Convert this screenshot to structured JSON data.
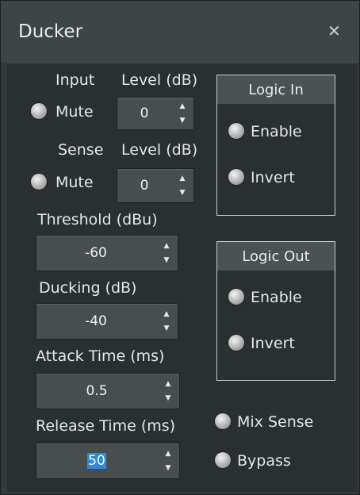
{
  "window": {
    "title": "Ducker",
    "close_icon": "close-icon"
  },
  "input": {
    "heading": "Input",
    "level_label": "Level (dB)",
    "mute_label": "Mute",
    "level_value": "0"
  },
  "sense": {
    "heading": "Sense",
    "level_label": "Level (dB)",
    "mute_label": "Mute",
    "level_value": "0"
  },
  "threshold": {
    "label": "Threshold (dBu)",
    "value": "-60"
  },
  "ducking": {
    "label": "Ducking (dB)",
    "value": "-40"
  },
  "attack": {
    "label": "Attack Time (ms)",
    "value": "0.5"
  },
  "release": {
    "label": "Release Time (ms)",
    "value": "50"
  },
  "logic_in": {
    "title": "Logic In",
    "enable_label": "Enable",
    "invert_label": "Invert"
  },
  "logic_out": {
    "title": "Logic Out",
    "enable_label": "Enable",
    "invert_label": "Invert"
  },
  "mix_sense": {
    "label": "Mix Sense"
  },
  "bypass": {
    "label": "Bypass"
  },
  "arrows": {
    "up": "▲",
    "down": "▼"
  }
}
